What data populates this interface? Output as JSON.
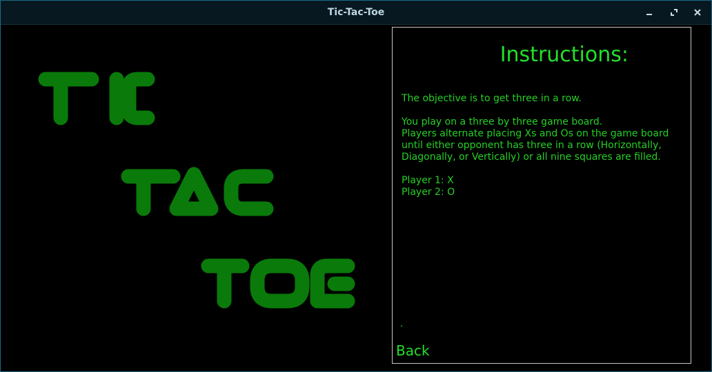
{
  "window": {
    "title": "Tic-Tac-Toe",
    "controls": [
      "minimize-icon",
      "maximize-icon",
      "close-icon"
    ],
    "title_color": "#bcd6e2"
  },
  "logo": {
    "words": [
      "TIC",
      "TAC",
      "TOE"
    ],
    "color": "#0a7a0a"
  },
  "instructions": {
    "heading": "Instructions:",
    "lines": [
      "The objective is to get three in a row.",
      "",
      "You play on a three by three game board.",
      "Players alternate placing Xs and Os on the game board",
      "until either opponent has three in a row (Horizontally,",
      "Diagonally, or Vertically) or all nine squares are filled.",
      "",
      "Player 1: X",
      "Player 2: O"
    ],
    "text_color": "#26d026"
  },
  "back_label": "Back"
}
